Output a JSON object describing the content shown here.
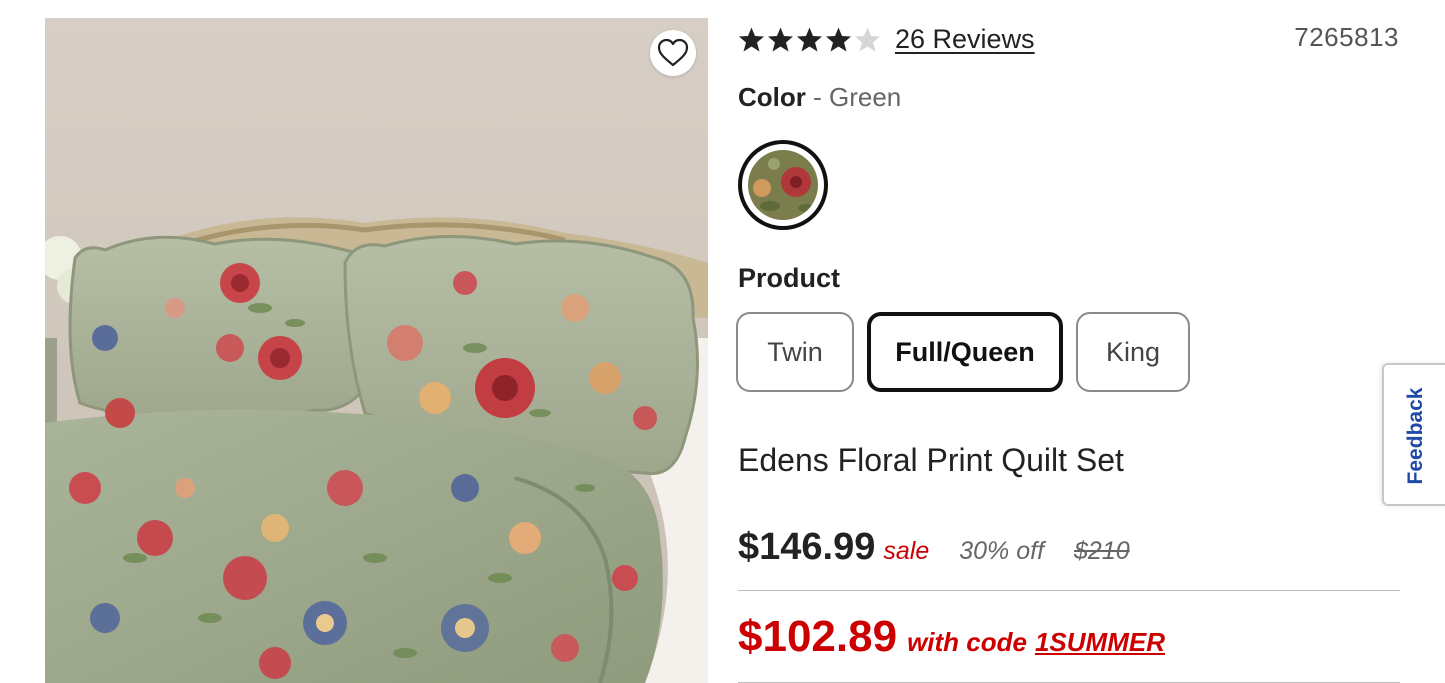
{
  "image": {
    "alt": "",
    "wishlist_icon": "heart-outline-icon"
  },
  "rating": {
    "value": 4,
    "max": 5,
    "reviews_label": "26 Reviews",
    "star_filled_color": "#222222",
    "star_empty_color": "#d6d6d6"
  },
  "sku": "7265813",
  "color": {
    "label": "Color",
    "separator": " - ",
    "value": "Green"
  },
  "product_section": {
    "label": "Product"
  },
  "sizes": [
    {
      "label": "Twin",
      "selected": false
    },
    {
      "label": "Full/Queen",
      "selected": true
    },
    {
      "label": "King",
      "selected": false
    }
  ],
  "title": "Edens Floral Print Quilt Set",
  "pricing": {
    "sale_price": "$146.99",
    "sale_tag": "sale",
    "percent_off": "30% off",
    "original_price": "$210",
    "promo_price": "$102.89",
    "promo_text": "with code",
    "promo_code": "1SUMMER",
    "accent_color": "#cc0000"
  },
  "feedback": {
    "label": "Feedback",
    "color": "#1f4aa8"
  }
}
